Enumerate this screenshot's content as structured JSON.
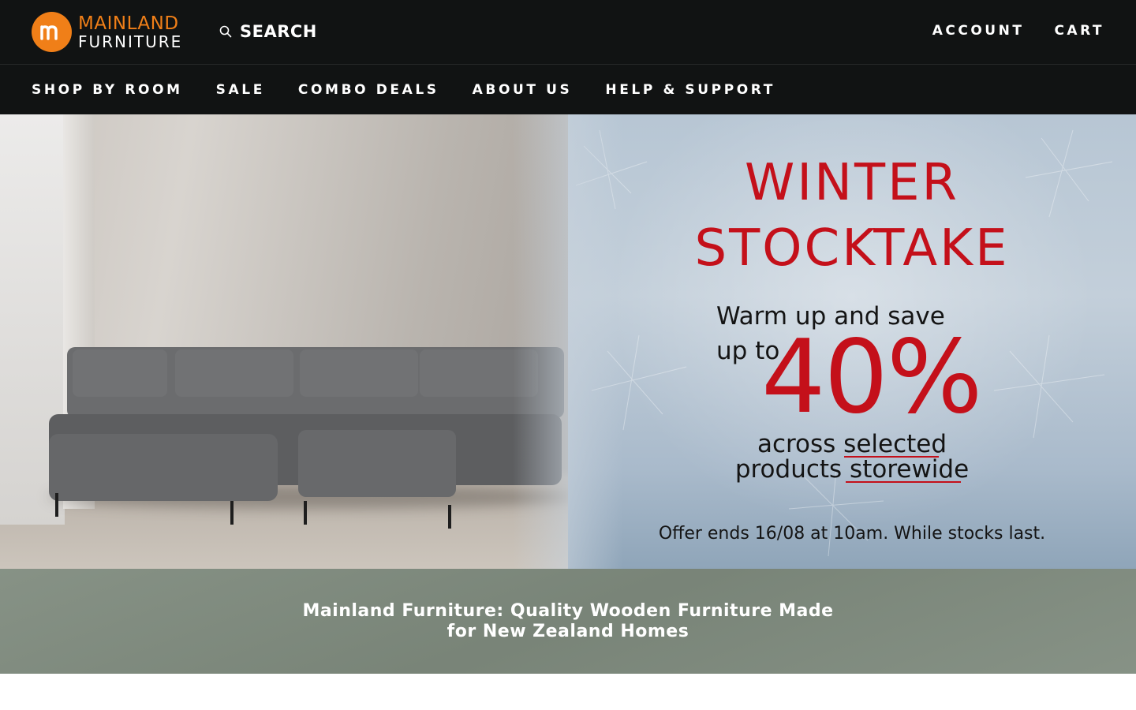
{
  "header": {
    "logo": {
      "mark": "m",
      "line1": "MAINLAND",
      "line2": "FURNITURE"
    },
    "search_label": "SEARCH",
    "account_label": "ACCOUNT",
    "cart_label": "CART"
  },
  "nav": {
    "items": [
      {
        "label": "SHOP BY ROOM"
      },
      {
        "label": "SALE"
      },
      {
        "label": "COMBO DEALS"
      },
      {
        "label": "ABOUT US"
      },
      {
        "label": "HELP & SUPPORT"
      }
    ]
  },
  "hero": {
    "title_line1": "WINTER",
    "title_line2": "STOCKTAKE",
    "warm_up": "Warm up and save",
    "up_to": "up to",
    "percent": "40%",
    "across": "across selected",
    "products": "products storewide",
    "offer": "Offer ends 16/08 at 10am. While stocks last."
  },
  "tagline": {
    "line1": "Mainland Furniture: Quality Wooden Furniture Made",
    "line2": "for New Zealand Homes"
  },
  "colors": {
    "header_bg": "#111313",
    "brand_orange": "#f07f18",
    "promo_red": "#c4101a",
    "strip_bg": "#7f8b7e"
  }
}
